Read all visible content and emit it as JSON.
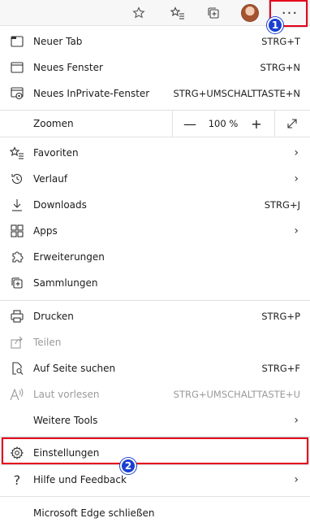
{
  "toolbar": {
    "icons": [
      "star-icon",
      "favorites-icon",
      "collections-icon",
      "avatar",
      "more-icon"
    ],
    "more_label": "···"
  },
  "menu": {
    "new_tab": {
      "label": "Neuer Tab",
      "shortcut": "STRG+T"
    },
    "new_window": {
      "label": "Neues Fenster",
      "shortcut": "STRG+N"
    },
    "new_private": {
      "label": "Neues InPrivate-Fenster",
      "shortcut": "STRG+UMSCHALTTASTE+N"
    },
    "zoom": {
      "label": "Zoomen",
      "minus": "—",
      "value": "100 %",
      "plus": "+"
    },
    "favorites": {
      "label": "Favoriten"
    },
    "history": {
      "label": "Verlauf"
    },
    "downloads": {
      "label": "Downloads",
      "shortcut": "STRG+J"
    },
    "apps": {
      "label": "Apps"
    },
    "extensions": {
      "label": "Erweiterungen"
    },
    "collections": {
      "label": "Sammlungen"
    },
    "print": {
      "label": "Drucken",
      "shortcut": "STRG+P"
    },
    "share": {
      "label": "Teilen"
    },
    "find": {
      "label": "Auf Seite suchen",
      "shortcut": "STRG+F"
    },
    "read_aloud": {
      "label": "Laut vorlesen",
      "shortcut": "STRG+UMSCHALTTASTE+U"
    },
    "more_tools": {
      "label": "Weitere Tools"
    },
    "settings": {
      "label": "Einstellungen"
    },
    "help": {
      "label": "Hilfe und Feedback"
    },
    "close": {
      "label": "Microsoft Edge schließen"
    }
  },
  "annotations": {
    "badge1": "1",
    "badge2": "2",
    "highlight_color": "#e3001b",
    "badge_color": "#1a3fd1"
  }
}
